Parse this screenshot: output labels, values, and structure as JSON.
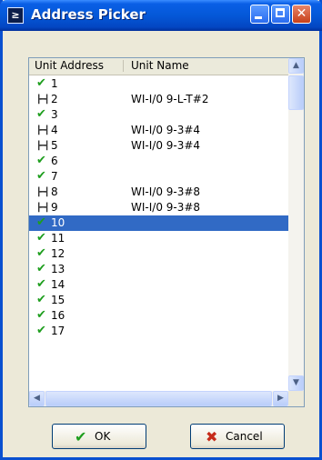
{
  "window": {
    "title": "Address Picker",
    "title_icon_glyph": "≥"
  },
  "list": {
    "columns": [
      "Unit Address",
      "Unit Name"
    ],
    "selected_address": "10",
    "rows": [
      {
        "address": "1",
        "name": "",
        "icon": "check-icon"
      },
      {
        "address": "2",
        "name": "WI-I/0 9-L-T#2",
        "icon": "wire-icon"
      },
      {
        "address": "3",
        "name": "",
        "icon": "check-icon"
      },
      {
        "address": "4",
        "name": "WI-I/0 9-3#4",
        "icon": "wire-icon"
      },
      {
        "address": "5",
        "name": "WI-I/0 9-3#4",
        "icon": "wire-icon"
      },
      {
        "address": "6",
        "name": "",
        "icon": "check-icon"
      },
      {
        "address": "7",
        "name": "",
        "icon": "check-icon"
      },
      {
        "address": "8",
        "name": "WI-I/0 9-3#8",
        "icon": "wire-icon"
      },
      {
        "address": "9",
        "name": "WI-I/0 9-3#8",
        "icon": "wire-icon"
      },
      {
        "address": "10",
        "name": "",
        "icon": "check-icon"
      },
      {
        "address": "11",
        "name": "",
        "icon": "check-icon"
      },
      {
        "address": "12",
        "name": "",
        "icon": "check-icon"
      },
      {
        "address": "13",
        "name": "",
        "icon": "check-icon"
      },
      {
        "address": "14",
        "name": "",
        "icon": "check-icon"
      },
      {
        "address": "15",
        "name": "",
        "icon": "check-icon"
      },
      {
        "address": "16",
        "name": "",
        "icon": "check-icon"
      },
      {
        "address": "17",
        "name": "",
        "icon": "check-icon"
      }
    ]
  },
  "buttons": {
    "ok_label": "OK",
    "cancel_label": "Cancel"
  },
  "colors": {
    "titlebar": "#0458d8",
    "selection": "#316ac5",
    "check": "#1e9e1e",
    "cancel_x": "#c62b1a"
  }
}
